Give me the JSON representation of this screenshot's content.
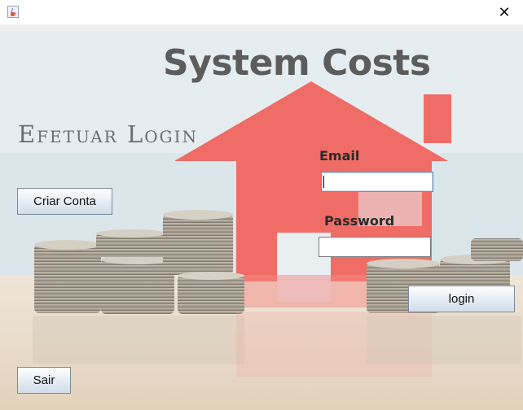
{
  "window": {
    "close_glyph": "✕",
    "app_icon": "java-coffee-icon"
  },
  "header": {
    "title": "System Costs",
    "subtitle": "Efetuar Login"
  },
  "form": {
    "email_label": "Email",
    "email_value": "",
    "password_label": "Password",
    "password_value": ""
  },
  "buttons": {
    "create_account": "Criar Conta",
    "login": "login",
    "exit": "Sair"
  },
  "colors": {
    "house": "#f0706a",
    "title_text": "#5c5c5c",
    "subtitle_text": "#6e6e6e"
  }
}
